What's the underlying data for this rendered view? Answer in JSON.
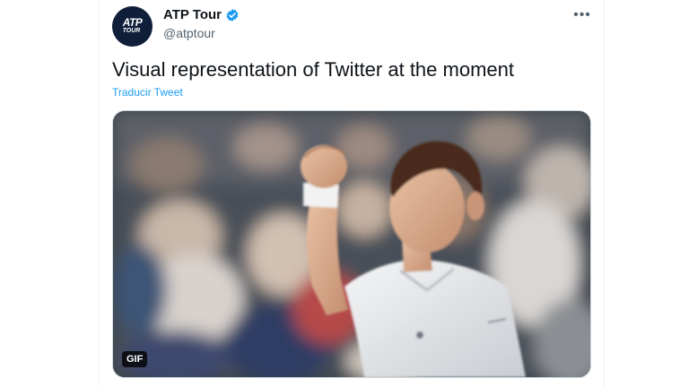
{
  "account": {
    "display_name": "ATP Tour",
    "handle": "@atptour",
    "avatar_logo_text": "ATP",
    "avatar_logo_sub": "TOUR",
    "verified_icon": "verified-badge-icon",
    "verified_color": "#1d9bf0"
  },
  "tweet": {
    "text": "Visual representation of Twitter at the moment",
    "translate_label": "Traducir Tweet"
  },
  "media": {
    "badge": "GIF",
    "alt": "tennis player raising fist in celebration"
  },
  "menu": {
    "more_icon": "more-options-icon",
    "more_glyph": "•••"
  }
}
